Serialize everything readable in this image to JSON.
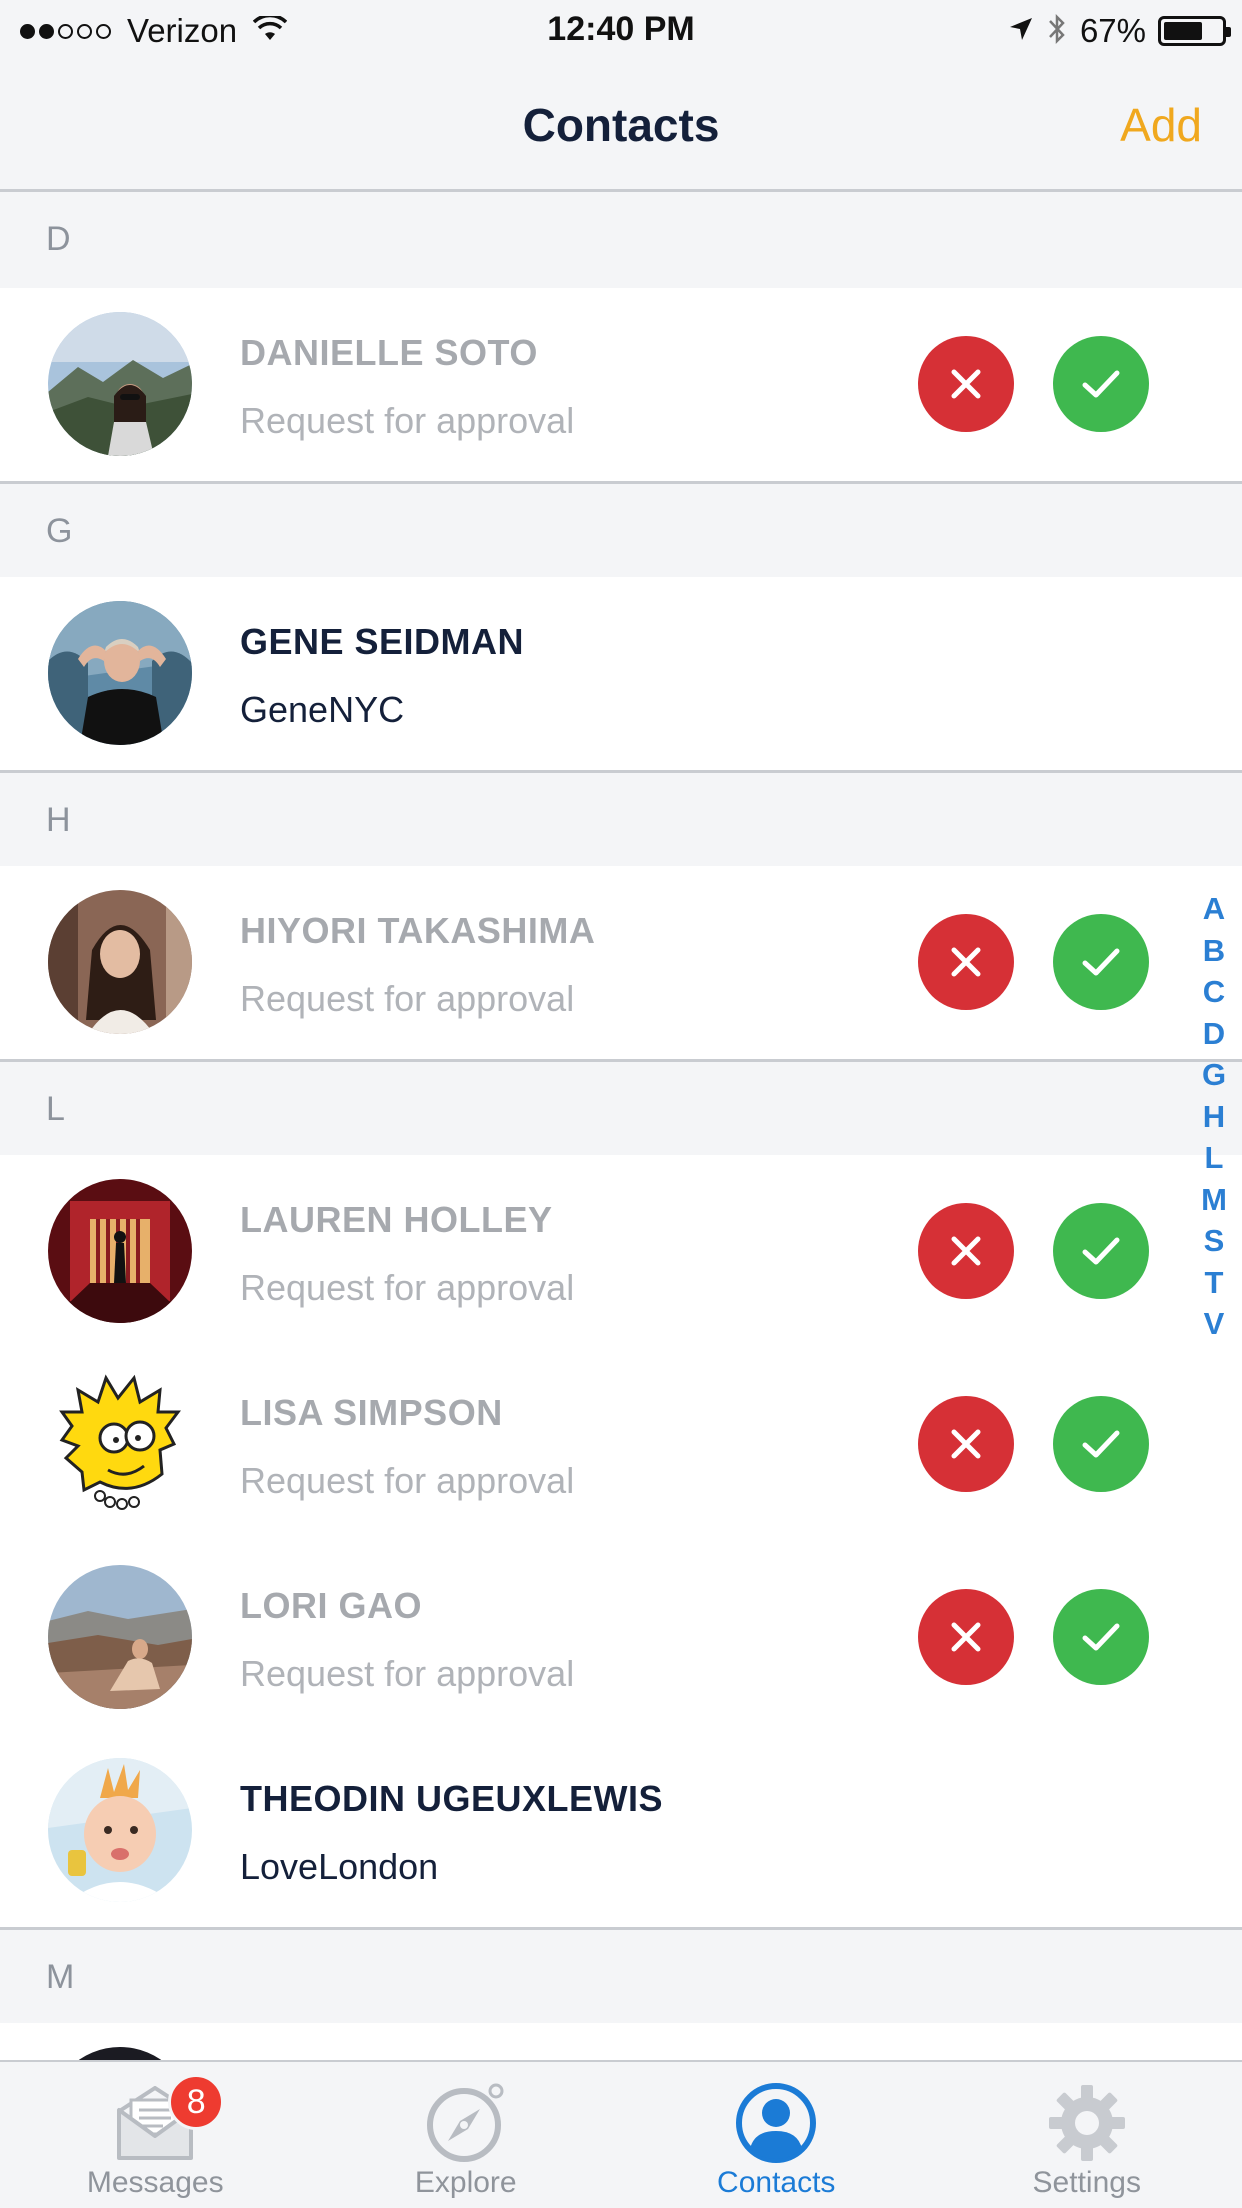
{
  "status_bar": {
    "carrier": "Verizon",
    "time": "12:40 PM",
    "battery_percent": "67%",
    "battery_level": 0.67,
    "signal_bars": 2,
    "signal_total": 5
  },
  "nav": {
    "title": "Contacts",
    "add_label": "Add"
  },
  "colors": {
    "accent": "#f0a81e",
    "reject": "#d63036",
    "accept": "#3fb84f",
    "index": "#2b7fd3"
  },
  "sections": [
    {
      "letter": "D",
      "rows": [
        {
          "name": "DANIELLE SOTO",
          "subtitle": "Request for approval",
          "status": "pending",
          "avatar": "mountain-photo"
        }
      ]
    },
    {
      "letter": "G",
      "rows": [
        {
          "name": "GENE SEIDMAN",
          "subtitle": "GeneNYC",
          "status": "accepted",
          "avatar": "man-photo"
        }
      ]
    },
    {
      "letter": "H",
      "rows": [
        {
          "name": "HIYORI TAKASHIMA",
          "subtitle": "Request for approval",
          "status": "pending",
          "avatar": "woman-photo"
        }
      ]
    },
    {
      "letter": "L",
      "rows": [
        {
          "name": "LAUREN HOLLEY",
          "subtitle": "Request for approval",
          "status": "pending",
          "avatar": "red-room-photo"
        },
        {
          "name": "LISA SIMPSON",
          "subtitle": "Request for approval",
          "status": "pending",
          "avatar": "cartoon-photo"
        },
        {
          "name": "LORI GAO",
          "subtitle": "Request for approval",
          "status": "pending",
          "avatar": "canyon-photo"
        },
        {
          "name": "THEODIN UGEUXLEWIS",
          "subtitle": "LoveLondon",
          "status": "accepted",
          "avatar": "baby-photo"
        }
      ]
    },
    {
      "letter": "M",
      "rows": []
    }
  ],
  "index_letters": [
    "A",
    "B",
    "C",
    "D",
    "G",
    "H",
    "L",
    "M",
    "S",
    "T",
    "V"
  ],
  "tabs": [
    {
      "label": "Messages",
      "icon": "envelope-icon",
      "badge": "8",
      "active": false
    },
    {
      "label": "Explore",
      "icon": "compass-icon",
      "badge": "",
      "active": false
    },
    {
      "label": "Contacts",
      "icon": "person-icon",
      "badge": "",
      "active": true
    },
    {
      "label": "Settings",
      "icon": "gear-icon",
      "badge": "",
      "active": false
    }
  ]
}
